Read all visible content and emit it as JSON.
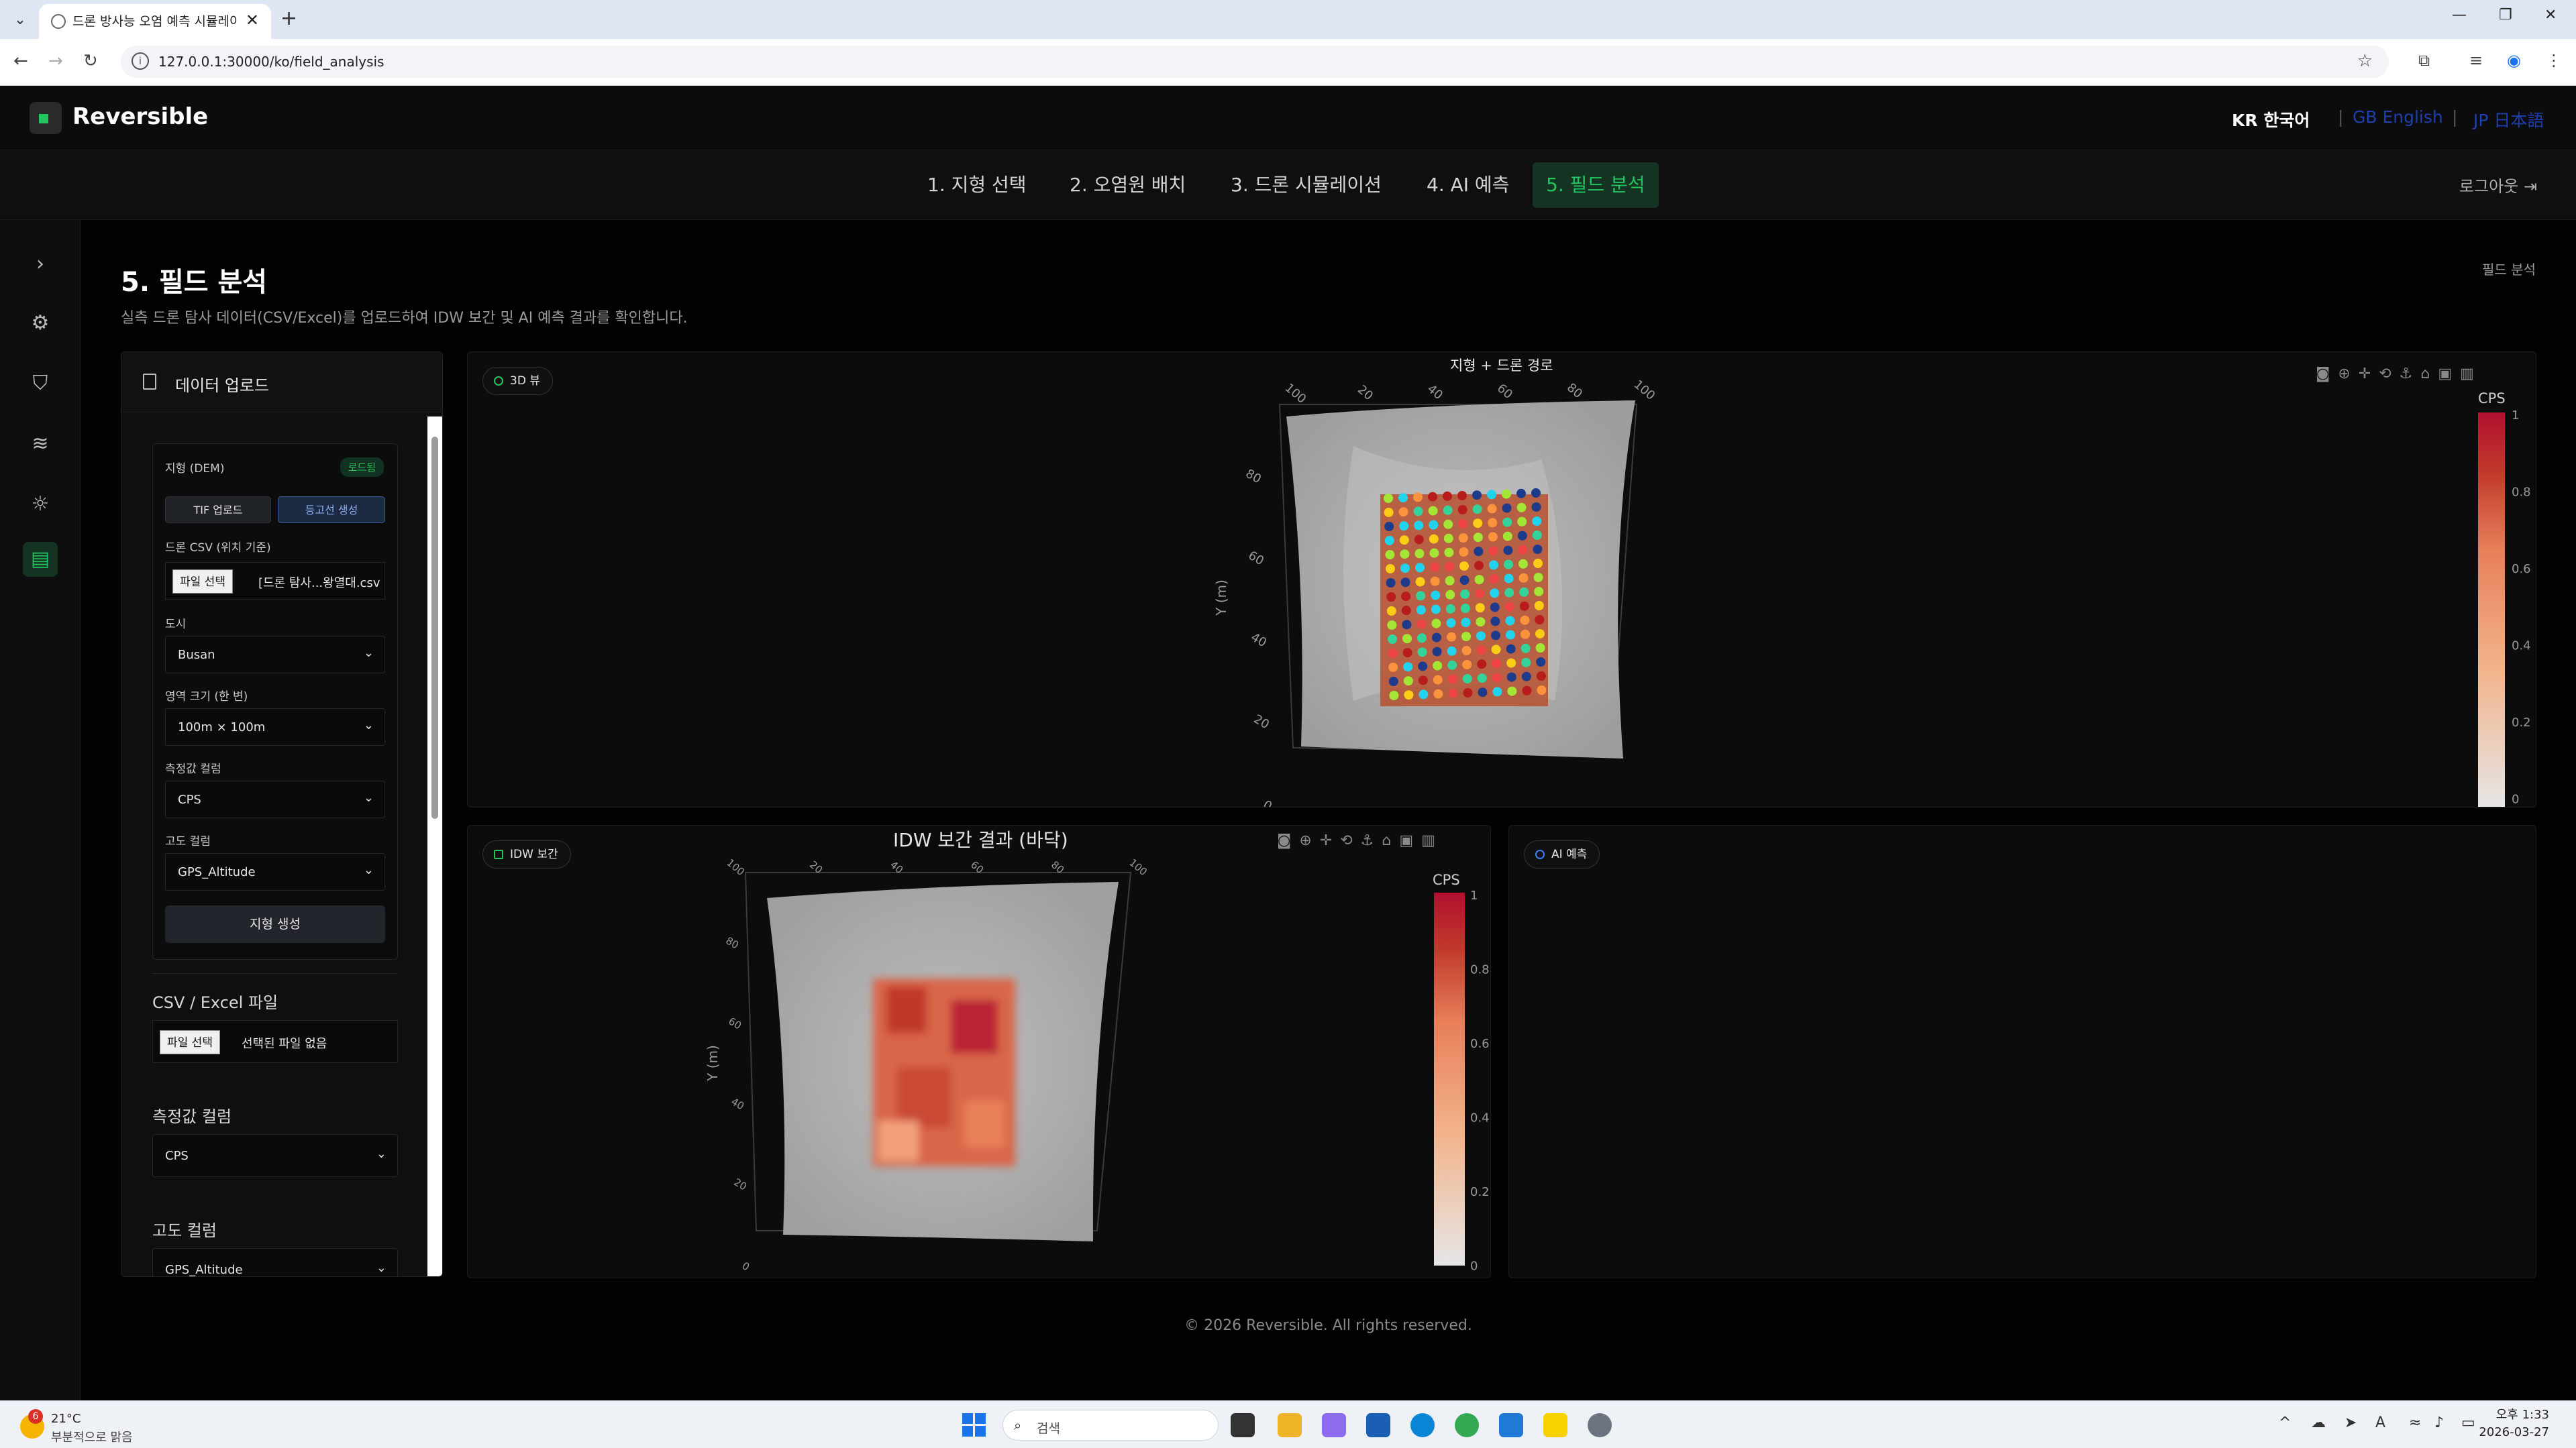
{
  "browser": {
    "tab_title": "드론 방사능 오염 예측 시뮬레이",
    "url": "127.0.0.1:30000/ko/field_analysis"
  },
  "header": {
    "logo_text": "Reversible",
    "languages": [
      "KR 한국어",
      "GB English",
      "JP 日本語"
    ]
  },
  "steps": [
    {
      "label": "1. 지형 선택",
      "active": false
    },
    {
      "label": "2. 오염원 배치",
      "active": false
    },
    {
      "label": "3. 드론 시뮬레이션",
      "active": false
    },
    {
      "label": "4. AI 예측",
      "active": false
    },
    {
      "label": "5. 필드 분석",
      "active": true
    }
  ],
  "logout_label": "로그아웃",
  "page": {
    "title": "5. 필드 분석",
    "description": "실측 드론 탐사 데이터(CSV/Excel)를 업로드하여 IDW 보간 및 AI 예측 결과를 확인합니다.",
    "breadcrumb": "필드 분석"
  },
  "upload_panel": {
    "title": "데이터 업로드",
    "dem": {
      "title": "지형 (DEM)",
      "badge": "로드됨",
      "tif_button": "TIF 업로드",
      "contour_button": "등고선 생성",
      "drone_csv_label": "드론 CSV (위치 기준)",
      "file_button": "파일 선택",
      "file_name": "[드론 탐사...왕열대.csv",
      "city_label": "도시",
      "city_value": "Busan",
      "area_label": "영역 크기 (한 변)",
      "area_value": "100m × 100m",
      "measure_label": "측정값 컬럼",
      "measure_value": "CPS",
      "alt_label": "고도 컬럼",
      "alt_value": "GPS_Altitude",
      "generate_button": "지형 생성"
    },
    "csv_label": "CSV / Excel 파일",
    "csv_file_button": "파일 선택",
    "csv_file_name": "선택된 파일 없음",
    "measure_label": "측정값 컬럼",
    "measure_value": "CPS",
    "alt_label": "고도 컬럼",
    "alt_value": "GPS_Altitude"
  },
  "cards": {
    "view3d": {
      "pill": "3D 뷰",
      "plot_title": "지형 + 드론 경로",
      "y_axis_title": "Y (m)",
      "colorbar_title": "CPS",
      "x_ticks": [
        "100",
        "20",
        "40",
        "60",
        "80",
        "100"
      ],
      "y_ticks": [
        "80",
        "60",
        "40",
        "20",
        "0"
      ],
      "cb_ticks": [
        "1",
        "0.8",
        "0.6",
        "0.4",
        "0.2",
        "0"
      ]
    },
    "idw": {
      "pill": "IDW 보간",
      "plot_title": "IDW 보간 결과 (바닥)",
      "y_axis_title": "Y (m)",
      "colorbar_title": "CPS",
      "x_ticks": [
        "100",
        "20",
        "40",
        "60",
        "80",
        "100"
      ],
      "y_ticks": [
        "80",
        "60",
        "40",
        "20",
        "0"
      ],
      "cb_ticks": [
        "1",
        "0.8",
        "0.6",
        "0.4",
        "0.2",
        "0"
      ]
    },
    "ai": {
      "pill": "AI 예측"
    }
  },
  "footer": "© 2026 Reversible. All rights reserved.",
  "taskbar": {
    "weather_badge": "6",
    "temperature": "21°C",
    "weather": "부분적으로 맑음",
    "search": "검색",
    "time": "오후 1:33",
    "date": "2026-03-27"
  },
  "colors": {
    "accent": "#22c55e",
    "background": "#000000",
    "colorscale": [
      "#e6e6e6",
      "#f2b48c",
      "#e8805a",
      "#c0392b",
      "#b10f2e"
    ]
  }
}
